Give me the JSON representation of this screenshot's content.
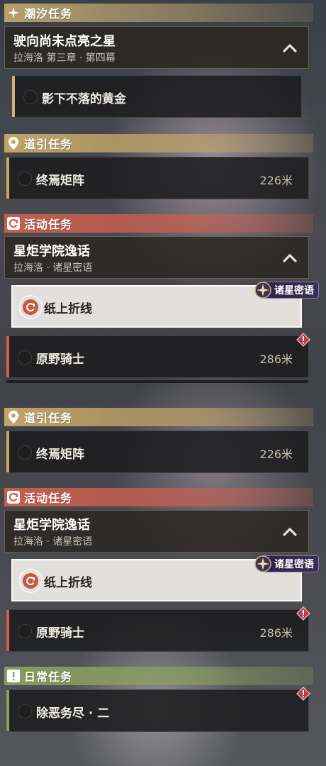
{
  "top": {
    "tide_section": {
      "label": "潮汐任务"
    },
    "tide_quest": {
      "title": "驶向尚未点亮之星",
      "subtitle": "拉海洛 第三章 · 第四幕"
    },
    "tide_task": {
      "name": "影下不落的黄金"
    },
    "guide_section": {
      "label": "道引任务"
    },
    "guide_task": {
      "name": "终焉矩阵",
      "distance": "226米"
    },
    "event_section": {
      "label": "活动任务"
    },
    "event_quest": {
      "title": "星炬学院逸话",
      "subtitle": "拉海洛 · 诸星密语"
    },
    "event_task_selected": {
      "name": "纸上折线",
      "badge": "诸星密语"
    },
    "event_task_2": {
      "name": "原野骑士",
      "distance": "286米"
    }
  },
  "bottom": {
    "guide_section": {
      "label": "道引任务"
    },
    "guide_task": {
      "name": "终焉矩阵",
      "distance": "226米"
    },
    "event_section": {
      "label": "活动任务"
    },
    "event_quest": {
      "title": "星炬学院逸话",
      "subtitle": "拉海洛 · 诸星密语"
    },
    "event_task_selected": {
      "name": "纸上折线",
      "badge": "诸星密语"
    },
    "event_task_2": {
      "name": "原野骑士",
      "distance": "286米"
    },
    "daily_section": {
      "label": "日常任务"
    },
    "daily_task": {
      "name": "除恶务尽 · 二"
    }
  },
  "colors": {
    "tide_accent": "#c9b27a",
    "guide_accent": "#c9a85e",
    "event_accent": "#d06050",
    "daily_accent": "#8fa05f"
  },
  "icons": {
    "tide": "sparkle-icon",
    "guide": "map-pin-icon",
    "event": "cycle-arrow-icon",
    "daily": "exclamation-box-icon",
    "collapse": "chevron-up-icon",
    "warning": "warning-diamond-icon"
  }
}
